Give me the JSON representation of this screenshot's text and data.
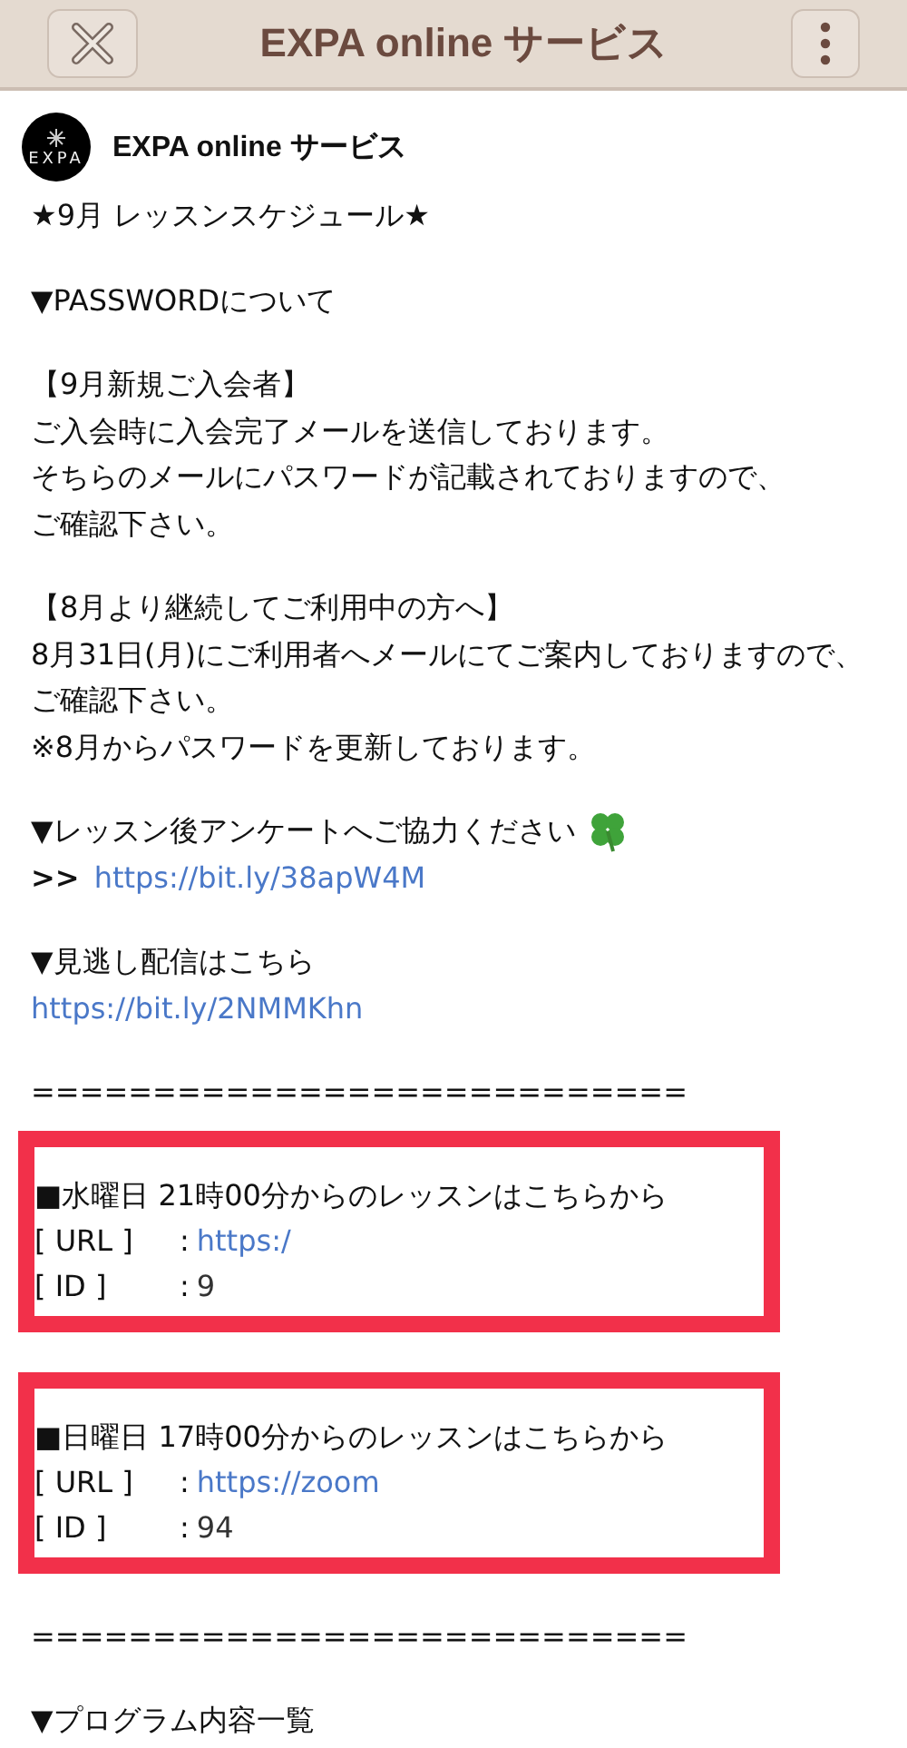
{
  "header": {
    "title": "EXPA online サービス"
  },
  "account": {
    "logo_text": "EXPA",
    "name": "EXPA online サービス"
  },
  "blocks": [
    {
      "kind": "text",
      "text": "★9月 レッスンスケジュール★"
    },
    {
      "kind": "blank"
    },
    {
      "kind": "text",
      "text": "▼PASSWORDについて"
    },
    {
      "kind": "blank"
    },
    {
      "kind": "text",
      "text": "【9月新規ご入会者】"
    },
    {
      "kind": "text",
      "text": "ご入会時に入会完了メールを送信しております。"
    },
    {
      "kind": "text",
      "text": "そちらのメールにパスワードが記載されておりますので、"
    },
    {
      "kind": "text",
      "text": "ご確認下さい。"
    },
    {
      "kind": "blank"
    },
    {
      "kind": "text",
      "text": "【8月より継続してご利用中の方へ】"
    },
    {
      "kind": "text",
      "text": "8月31日(月)にご利用者へメールにてご案内しておりますので、ご確認下さい。"
    },
    {
      "kind": "text",
      "text": "※8月からパスワードを更新しております。"
    },
    {
      "kind": "blank"
    },
    {
      "kind": "clover",
      "text": "▼レッスン後アンケートへご協力ください"
    },
    {
      "kind": "link",
      "prefix": ">>",
      "url": "https://bit.ly/38apW4M"
    },
    {
      "kind": "blank"
    },
    {
      "kind": "text",
      "text": "▼見逃し配信はこちら"
    },
    {
      "kind": "link",
      "url": "https://bit.ly/2NMMKhn"
    },
    {
      "kind": "blank"
    },
    {
      "kind": "text",
      "text": "==========================="
    },
    {
      "kind": "box",
      "heading": "■水曜日 21時00分からのレッスンはこちらから",
      "fields": [
        {
          "label": "[ URL ]",
          "separator": ":",
          "value": "https:/",
          "kind": "link"
        },
        {
          "label": "[ ID ]",
          "separator": ":",
          "value": "9",
          "kind": "text"
        }
      ]
    },
    {
      "kind": "box",
      "heading": "■日曜日 17時00分からのレッスンはこちらから",
      "fields": [
        {
          "label": "[ URL ]",
          "separator": ":",
          "value": "https://zoom",
          "kind": "link"
        },
        {
          "label": "[ ID ]",
          "separator": ":",
          "value": "94",
          "kind": "text"
        }
      ]
    },
    {
      "kind": "text",
      "text": "==========================="
    },
    {
      "kind": "blank"
    },
    {
      "kind": "text",
      "text": "▼プログラム内容一覧"
    }
  ]
}
